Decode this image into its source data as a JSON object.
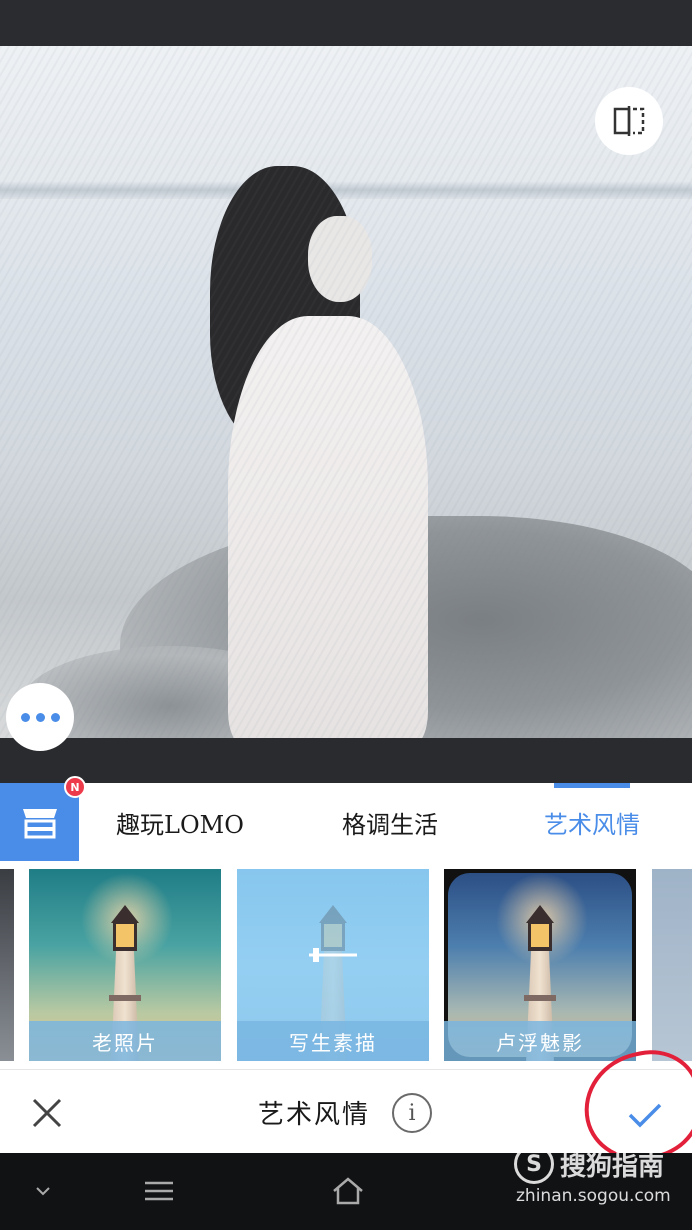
{
  "header": {},
  "photo": {
    "compare_icon": "split-compare-icon",
    "more_icon": "more-dots-icon"
  },
  "tabs": {
    "store_icon": "store-icon",
    "new_badge": "N",
    "items": [
      {
        "label": "趣玩LOMO",
        "active": false
      },
      {
        "label": "格调生活",
        "active": false
      },
      {
        "label": "艺术风情",
        "active": true
      }
    ]
  },
  "filters": {
    "items": [
      {
        "label": "老照片"
      },
      {
        "label": "写生素描"
      },
      {
        "label": "卢浮魅影"
      }
    ]
  },
  "bottombar": {
    "close_icon": "close-icon",
    "title": "艺术风情",
    "info_label": "i",
    "confirm_icon": "check-icon"
  },
  "navbar": {
    "items": [
      "chevron-down-icon",
      "menu-icon",
      "home-icon"
    ]
  },
  "watermark": {
    "logo": "S",
    "title": "搜狗指南",
    "url": "zhinan.sogou.com"
  },
  "colors": {
    "accent": "#4a8de8",
    "badge": "#ee3b4b",
    "annotation": "#e3203a"
  }
}
